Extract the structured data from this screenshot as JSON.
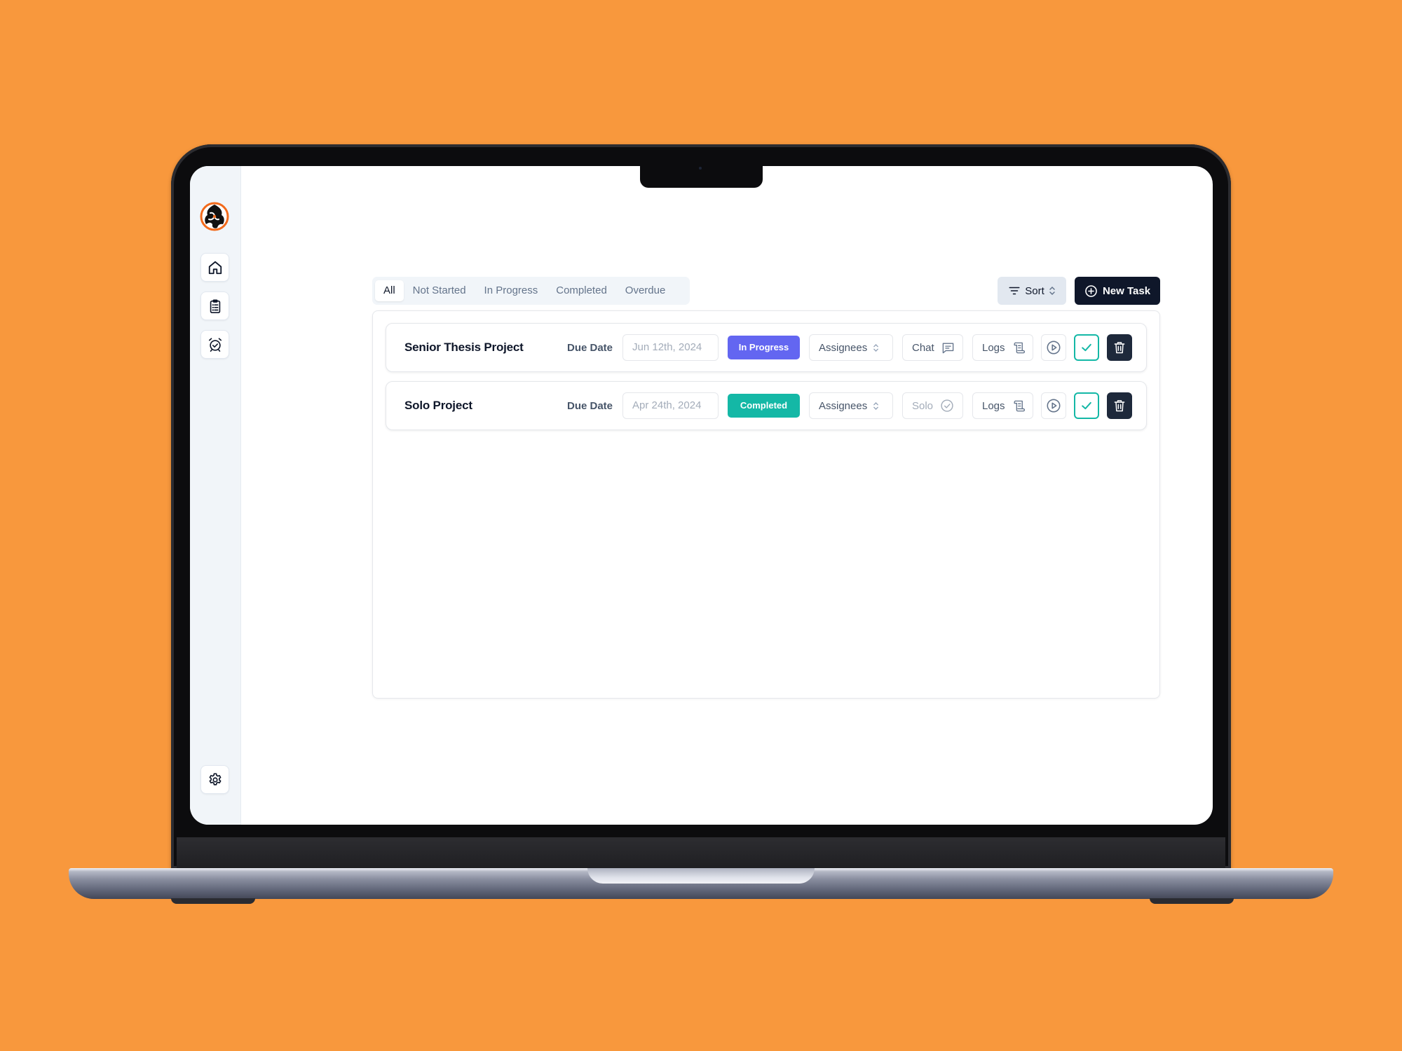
{
  "tabs": [
    {
      "label": "All",
      "active": true
    },
    {
      "label": "Not Started",
      "active": false
    },
    {
      "label": "In Progress",
      "active": false
    },
    {
      "label": "Completed",
      "active": false
    },
    {
      "label": "Overdue",
      "active": false
    }
  ],
  "toolbar": {
    "sort_label": "Sort",
    "new_task_label": "New Task"
  },
  "sidebar": {
    "logo": "app-logo",
    "items": [
      {
        "icon": "home-icon"
      },
      {
        "icon": "clipboard-list-icon"
      },
      {
        "icon": "alarm-clock-icon"
      }
    ],
    "settings_icon": "gear-icon"
  },
  "tasks": [
    {
      "title": "Senior Thesis Project",
      "due_label": "Due Date",
      "due_date": "Jun 12th, 2024",
      "status": "In Progress",
      "status_color": "#6366F1",
      "assignees_label": "Assignees",
      "chat_label": "Chat",
      "logs_label": "Logs"
    },
    {
      "title": "Solo Project",
      "due_label": "Due Date",
      "due_date": "Apr 24th, 2024",
      "status": "Completed",
      "status_color": "#14B8A6",
      "assignees_label": "Assignees",
      "chat_label": "Solo",
      "logs_label": "Logs"
    }
  ],
  "colors": {
    "background": "#F8983D",
    "primary_dark": "#0F172A",
    "accent_teal": "#14B8A6",
    "accent_indigo": "#6366F1"
  }
}
